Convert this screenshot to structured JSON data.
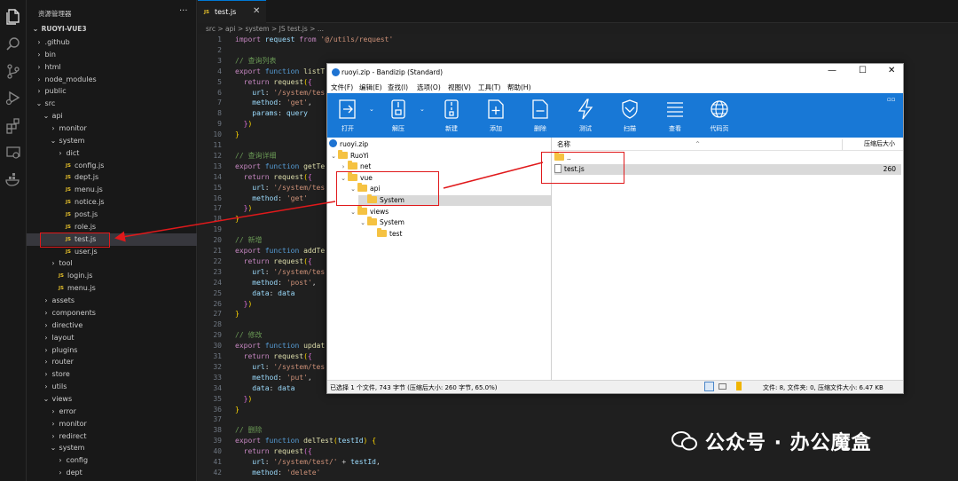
{
  "explorer": {
    "title": "资源管理器",
    "more": "···",
    "root": "RUOYI-VUE3",
    "items": [
      {
        "label": ".github",
        "kind": "dir",
        "open": false,
        "depth": 0
      },
      {
        "label": "bin",
        "kind": "dir",
        "open": false,
        "depth": 0
      },
      {
        "label": "html",
        "kind": "dir",
        "open": false,
        "depth": 0
      },
      {
        "label": "node_modules",
        "kind": "dir",
        "open": false,
        "depth": 0
      },
      {
        "label": "public",
        "kind": "dir",
        "open": false,
        "depth": 0
      },
      {
        "label": "src",
        "kind": "dir",
        "open": true,
        "depth": 0
      },
      {
        "label": "api",
        "kind": "dir",
        "open": true,
        "depth": 1
      },
      {
        "label": "monitor",
        "kind": "dir",
        "open": false,
        "depth": 2
      },
      {
        "label": "system",
        "kind": "dir",
        "open": true,
        "depth": 2
      },
      {
        "label": "dict",
        "kind": "dir",
        "open": false,
        "depth": 3
      },
      {
        "label": "config.js",
        "kind": "js",
        "depth": 3
      },
      {
        "label": "dept.js",
        "kind": "js",
        "depth": 3
      },
      {
        "label": "menu.js",
        "kind": "js",
        "depth": 3
      },
      {
        "label": "notice.js",
        "kind": "js",
        "depth": 3
      },
      {
        "label": "post.js",
        "kind": "js",
        "depth": 3
      },
      {
        "label": "role.js",
        "kind": "js",
        "depth": 3
      },
      {
        "label": "test.js",
        "kind": "js",
        "depth": 3,
        "selected": true
      },
      {
        "label": "user.js",
        "kind": "js",
        "depth": 3
      },
      {
        "label": "tool",
        "kind": "dir",
        "open": false,
        "depth": 2
      },
      {
        "label": "login.js",
        "kind": "js",
        "depth": 2
      },
      {
        "label": "menu.js",
        "kind": "js",
        "depth": 2
      },
      {
        "label": "assets",
        "kind": "dir",
        "open": false,
        "depth": 1
      },
      {
        "label": "components",
        "kind": "dir",
        "open": false,
        "depth": 1
      },
      {
        "label": "directive",
        "kind": "dir",
        "open": false,
        "depth": 1
      },
      {
        "label": "layout",
        "kind": "dir",
        "open": false,
        "depth": 1
      },
      {
        "label": "plugins",
        "kind": "dir",
        "open": false,
        "depth": 1
      },
      {
        "label": "router",
        "kind": "dir",
        "open": false,
        "depth": 1
      },
      {
        "label": "store",
        "kind": "dir",
        "open": false,
        "depth": 1
      },
      {
        "label": "utils",
        "kind": "dir",
        "open": false,
        "depth": 1
      },
      {
        "label": "views",
        "kind": "dir",
        "open": true,
        "depth": 1
      },
      {
        "label": "error",
        "kind": "dir",
        "open": false,
        "depth": 2
      },
      {
        "label": "monitor",
        "kind": "dir",
        "open": false,
        "depth": 2
      },
      {
        "label": "redirect",
        "kind": "dir",
        "open": false,
        "depth": 2
      },
      {
        "label": "system",
        "kind": "dir",
        "open": true,
        "depth": 2
      },
      {
        "label": "config",
        "kind": "dir",
        "open": false,
        "depth": 3
      },
      {
        "label": "dept",
        "kind": "dir",
        "open": false,
        "depth": 3
      }
    ]
  },
  "editor": {
    "tab": {
      "badge": "JS",
      "label": "test.js",
      "close": "✕"
    },
    "breadcrumb": "src > api > system > JS test.js > ...",
    "lines": [
      {
        "n": "1",
        "t": [
          [
            "kw2",
            "import"
          ],
          [
            "pl",
            " "
          ],
          [
            "id",
            "request"
          ],
          [
            "pl",
            " "
          ],
          [
            "kw2",
            "from"
          ],
          [
            "pl",
            " "
          ],
          [
            "str",
            "'@/utils/request'"
          ]
        ]
      },
      {
        "n": "2",
        "t": []
      },
      {
        "n": "3",
        "t": [
          [
            "cm",
            "// 查询列表"
          ]
        ]
      },
      {
        "n": "4",
        "t": [
          [
            "kw2",
            "export"
          ],
          [
            "pl",
            " "
          ],
          [
            "kw",
            "function"
          ],
          [
            "pl",
            " "
          ],
          [
            "fn",
            "listT"
          ]
        ]
      },
      {
        "n": "5",
        "t": [
          [
            "pl",
            "  "
          ],
          [
            "kw2",
            "return"
          ],
          [
            "pl",
            " "
          ],
          [
            "fn",
            "request"
          ],
          [
            "br1",
            "("
          ],
          [
            "br2",
            "{"
          ]
        ]
      },
      {
        "n": "6",
        "t": [
          [
            "pl",
            "    "
          ],
          [
            "id",
            "url"
          ],
          [
            "pl",
            ": "
          ],
          [
            "str",
            "'/system/tes"
          ]
        ]
      },
      {
        "n": "7",
        "t": [
          [
            "pl",
            "    "
          ],
          [
            "id",
            "method"
          ],
          [
            "pl",
            ": "
          ],
          [
            "str",
            "'get'"
          ],
          [
            "pl",
            ","
          ]
        ]
      },
      {
        "n": "8",
        "t": [
          [
            "pl",
            "    "
          ],
          [
            "id",
            "params"
          ],
          [
            "pl",
            ": "
          ],
          [
            "id",
            "query"
          ]
        ]
      },
      {
        "n": "9",
        "t": [
          [
            "pl",
            "  "
          ],
          [
            "br2",
            "}"
          ],
          [
            "br1",
            ")"
          ]
        ]
      },
      {
        "n": "10",
        "t": [
          [
            "br1",
            "}"
          ]
        ]
      },
      {
        "n": "11",
        "t": []
      },
      {
        "n": "12",
        "t": [
          [
            "cm",
            "// 查询详细"
          ]
        ]
      },
      {
        "n": "13",
        "t": [
          [
            "kw2",
            "export"
          ],
          [
            "pl",
            " "
          ],
          [
            "kw",
            "function"
          ],
          [
            "pl",
            " "
          ],
          [
            "fn",
            "getTe"
          ]
        ]
      },
      {
        "n": "14",
        "t": [
          [
            "pl",
            "  "
          ],
          [
            "kw2",
            "return"
          ],
          [
            "pl",
            " "
          ],
          [
            "fn",
            "request"
          ],
          [
            "br1",
            "("
          ],
          [
            "br2",
            "{"
          ]
        ]
      },
      {
        "n": "15",
        "t": [
          [
            "pl",
            "    "
          ],
          [
            "id",
            "url"
          ],
          [
            "pl",
            ": "
          ],
          [
            "str",
            "'/system/tes"
          ]
        ]
      },
      {
        "n": "16",
        "t": [
          [
            "pl",
            "    "
          ],
          [
            "id",
            "method"
          ],
          [
            "pl",
            ": "
          ],
          [
            "str",
            "'get'"
          ]
        ]
      },
      {
        "n": "17",
        "t": [
          [
            "pl",
            "  "
          ],
          [
            "br2",
            "}"
          ],
          [
            "br1",
            ")"
          ]
        ]
      },
      {
        "n": "18",
        "t": [
          [
            "br1",
            "}"
          ]
        ]
      },
      {
        "n": "19",
        "t": []
      },
      {
        "n": "20",
        "t": [
          [
            "cm",
            "// 新增"
          ]
        ]
      },
      {
        "n": "21",
        "t": [
          [
            "kw2",
            "export"
          ],
          [
            "pl",
            " "
          ],
          [
            "kw",
            "function"
          ],
          [
            "pl",
            " "
          ],
          [
            "fn",
            "addTe"
          ]
        ]
      },
      {
        "n": "22",
        "t": [
          [
            "pl",
            "  "
          ],
          [
            "kw2",
            "return"
          ],
          [
            "pl",
            " "
          ],
          [
            "fn",
            "request"
          ],
          [
            "br1",
            "("
          ],
          [
            "br2",
            "{"
          ]
        ]
      },
      {
        "n": "23",
        "t": [
          [
            "pl",
            "    "
          ],
          [
            "id",
            "url"
          ],
          [
            "pl",
            ": "
          ],
          [
            "str",
            "'/system/tes"
          ]
        ]
      },
      {
        "n": "24",
        "t": [
          [
            "pl",
            "    "
          ],
          [
            "id",
            "method"
          ],
          [
            "pl",
            ": "
          ],
          [
            "str",
            "'post'"
          ],
          [
            "pl",
            ","
          ]
        ]
      },
      {
        "n": "25",
        "t": [
          [
            "pl",
            "    "
          ],
          [
            "id",
            "data"
          ],
          [
            "pl",
            ": "
          ],
          [
            "id",
            "data"
          ]
        ]
      },
      {
        "n": "26",
        "t": [
          [
            "pl",
            "  "
          ],
          [
            "br2",
            "}"
          ],
          [
            "br1",
            ")"
          ]
        ]
      },
      {
        "n": "27",
        "t": [
          [
            "br1",
            "}"
          ]
        ]
      },
      {
        "n": "28",
        "t": []
      },
      {
        "n": "29",
        "t": [
          [
            "cm",
            "// 修改"
          ]
        ]
      },
      {
        "n": "30",
        "t": [
          [
            "kw2",
            "export"
          ],
          [
            "pl",
            " "
          ],
          [
            "kw",
            "function"
          ],
          [
            "pl",
            " "
          ],
          [
            "fn",
            "updat"
          ]
        ]
      },
      {
        "n": "31",
        "t": [
          [
            "pl",
            "  "
          ],
          [
            "kw2",
            "return"
          ],
          [
            "pl",
            " "
          ],
          [
            "fn",
            "request"
          ],
          [
            "br1",
            "("
          ],
          [
            "br2",
            "{"
          ]
        ]
      },
      {
        "n": "32",
        "t": [
          [
            "pl",
            "    "
          ],
          [
            "id",
            "url"
          ],
          [
            "pl",
            ": "
          ],
          [
            "str",
            "'/system/tes"
          ]
        ]
      },
      {
        "n": "33",
        "t": [
          [
            "pl",
            "    "
          ],
          [
            "id",
            "method"
          ],
          [
            "pl",
            ": "
          ],
          [
            "str",
            "'put'"
          ],
          [
            "pl",
            ","
          ]
        ]
      },
      {
        "n": "34",
        "t": [
          [
            "pl",
            "    "
          ],
          [
            "id",
            "data"
          ],
          [
            "pl",
            ": "
          ],
          [
            "id",
            "data"
          ]
        ]
      },
      {
        "n": "35",
        "t": [
          [
            "pl",
            "  "
          ],
          [
            "br2",
            "}"
          ],
          [
            "br1",
            ")"
          ]
        ]
      },
      {
        "n": "36",
        "t": [
          [
            "br1",
            "}"
          ]
        ]
      },
      {
        "n": "37",
        "t": []
      },
      {
        "n": "38",
        "t": [
          [
            "cm",
            "// 删除"
          ]
        ]
      },
      {
        "n": "39",
        "t": [
          [
            "kw2",
            "export"
          ],
          [
            "pl",
            " "
          ],
          [
            "kw",
            "function"
          ],
          [
            "pl",
            " "
          ],
          [
            "fn",
            "delTest"
          ],
          [
            "br1",
            "("
          ],
          [
            "id",
            "testId"
          ],
          [
            "br1",
            ")"
          ],
          [
            "pl",
            " "
          ],
          [
            "br1",
            "{"
          ]
        ]
      },
      {
        "n": "40",
        "t": [
          [
            "pl",
            "  "
          ],
          [
            "kw2",
            "return"
          ],
          [
            "pl",
            " "
          ],
          [
            "fn",
            "request"
          ],
          [
            "br2",
            "("
          ],
          [
            "br2",
            "{"
          ]
        ]
      },
      {
        "n": "41",
        "t": [
          [
            "pl",
            "    "
          ],
          [
            "id",
            "url"
          ],
          [
            "pl",
            ": "
          ],
          [
            "str",
            "'/system/test/'"
          ],
          [
            "pl",
            " + "
          ],
          [
            "id",
            "testId"
          ],
          [
            "pl",
            ","
          ]
        ]
      },
      {
        "n": "42",
        "t": [
          [
            "pl",
            "    "
          ],
          [
            "id",
            "method"
          ],
          [
            "pl",
            ": "
          ],
          [
            "str",
            "'delete'"
          ]
        ]
      }
    ]
  },
  "bandizip": {
    "title": "ruoyi.zip - Bandizip (Standard)",
    "window_buttons": [
      "—",
      "☐",
      "✕"
    ],
    "menu": [
      "文件(F)",
      "编辑(E)",
      "查找(I)",
      "选项(O)",
      "视图(V)",
      "工具(T)",
      "帮助(H)"
    ],
    "toolbar": [
      {
        "label": "打开",
        "icon": "open-icon"
      },
      {
        "label": "解压",
        "icon": "extract-icon"
      },
      {
        "label": "新建",
        "icon": "new-archive-icon"
      },
      {
        "label": "添加",
        "icon": "add-file-icon"
      },
      {
        "label": "删除",
        "icon": "delete-file-icon"
      },
      {
        "label": "测试",
        "icon": "test-icon"
      },
      {
        "label": "扫描",
        "icon": "scan-shield-icon"
      },
      {
        "label": "查看",
        "icon": "view-list-icon"
      },
      {
        "label": "代码页",
        "icon": "codepage-globe-icon"
      }
    ],
    "toolbar_extra": "▫▫",
    "tree": [
      {
        "label": "ruoyi.zip",
        "kind": "zip",
        "depth": 0
      },
      {
        "label": "RuoYi",
        "kind": "dir",
        "open": true,
        "depth": 0
      },
      {
        "label": "net",
        "kind": "dir",
        "open": false,
        "depth": 1
      },
      {
        "label": "vue",
        "kind": "dir",
        "open": true,
        "depth": 1
      },
      {
        "label": "api",
        "kind": "dir",
        "open": true,
        "depth": 2
      },
      {
        "label": "System",
        "kind": "dir",
        "open": null,
        "depth": 3,
        "selected": true
      },
      {
        "label": "views",
        "kind": "dir",
        "open": true,
        "depth": 2
      },
      {
        "label": "System",
        "kind": "dir",
        "open": true,
        "depth": 3
      },
      {
        "label": "test",
        "kind": "dir",
        "open": null,
        "depth": 4
      }
    ],
    "columns": {
      "name": "名称",
      "size": "压缩后大小"
    },
    "files": [
      {
        "name": "..",
        "kind": "up",
        "size": ""
      },
      {
        "name": "test.js",
        "kind": "file",
        "size": "260"
      }
    ],
    "status_left": "已选择 1 个文件, 743 字节 (压缩后大小: 260 字节, 65.0%)",
    "status_right": "文件: 8, 文件夹: 0, 压缩文件大小: 6.47 KB"
  },
  "watermark": {
    "text": "公众号 · 办公魔盒"
  },
  "colors": {
    "annotation_red": "#e0191b",
    "toolbar_blue": "#1878d6",
    "js_yellow": "#e8c22b"
  }
}
